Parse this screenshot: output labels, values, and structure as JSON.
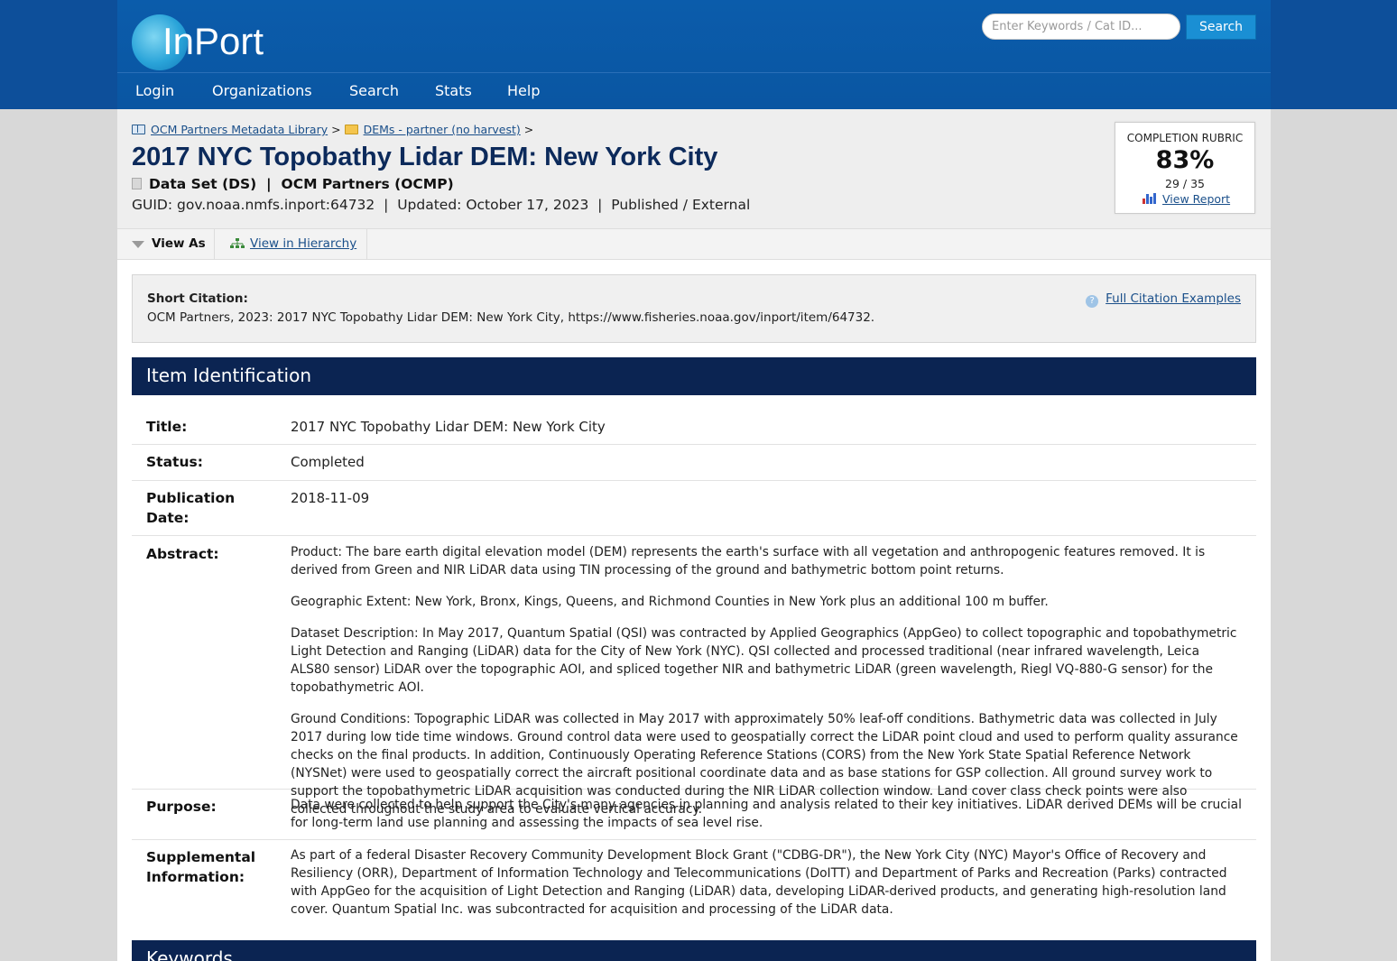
{
  "header": {
    "logo_text": "InPort",
    "search_placeholder": "Enter Keywords / Cat ID...",
    "search_button": "Search",
    "nav": [
      "Login",
      "Organizations",
      "Search",
      "Stats",
      "Help"
    ]
  },
  "breadcrumb": {
    "library": "OCM Partners Metadata Library",
    "sep1": ">",
    "folder": "DEMs - partner (no harvest)",
    "sep2": ">"
  },
  "item": {
    "title": "2017 NYC Topobathy Lidar DEM: New York City",
    "type_line": "Data Set (DS)  |  OCM Partners (OCMP)",
    "meta_line": "GUID: gov.noaa.nmfs.inport:64732  |  Updated: October 17, 2023  |  Published / External"
  },
  "rubric": {
    "label": "COMPLETION RUBRIC",
    "percent": "83%",
    "count": "29 / 35",
    "link": "View Report"
  },
  "viewbar": {
    "view_as": "View As",
    "hierarchy": "View in Hierarchy"
  },
  "citation": {
    "label": "Short Citation:",
    "text": "OCM Partners, 2023: 2017 NYC Topobathy Lidar DEM: New York City, https://www.fisheries.noaa.gov/inport/item/64732.",
    "link": "Full Citation Examples"
  },
  "sections": {
    "item_identification": "Item Identification",
    "keywords": "Keywords"
  },
  "identification": {
    "title_label": "Title:",
    "title_value": "2017 NYC Topobathy Lidar DEM: New York City",
    "status_label": "Status:",
    "status_value": "Completed",
    "pubdate_label_1": "Publication",
    "pubdate_label_2": "Date:",
    "pubdate_value": "2018-11-09",
    "abstract_label": "Abstract:",
    "abstract_p1": "Product: The bare earth digital elevation model (DEM) represents the earth's surface with all vegetation and anthropogenic features removed. It is derived from Green and NIR LiDAR data using TIN processing of the ground and bathymetric bottom point returns.",
    "abstract_p2": "Geographic Extent: New York, Bronx, Kings, Queens, and Richmond Counties in New York plus an additional 100 m buffer.",
    "abstract_p3": "Dataset Description: In May 2017, Quantum Spatial (QSI) was contracted by Applied Geographics (AppGeo) to collect topographic and topobathymetric Light Detection and Ranging (LiDAR) data for the City of New York (NYC). QSI collected and processed traditional (near infrared wavelength, Leica ALS80 sensor) LiDAR over the topographic AOI, and spliced together NIR and bathymetric LiDAR (green wavelength, Riegl VQ-880-G sensor) for the topobathymetric AOI.",
    "abstract_p4": "Ground Conditions: Topographic LiDAR was collected in May 2017 with approximately 50% leaf-off conditions. Bathymetric data was collected in July 2017 during low tide time windows. Ground control data were used to geospatially correct the LiDAR point cloud and used to perform quality assurance checks on the final products. In addition, Continuously Operating Reference Stations (CORS) from the New York State Spatial Reference Network (NYSNet) were used to geospatially correct the aircraft positional coordinate data and as base stations for GSP collection. All ground survey work to support the topobathymetric LiDAR acquisition was conducted during the NIR LiDAR collection window. Land cover class check points were also collected throughout the study area to evaluate vertical accuracy.",
    "purpose_label": "Purpose:",
    "purpose_value": "Data were collected to help support the City's many agencies in planning and analysis related to their key initiatives. LiDAR derived DEMs will be crucial for long-term land use planning and assessing the impacts of sea level rise.",
    "supp_label_1": "Supplemental",
    "supp_label_2": "Information:",
    "supp_value": "As part of a federal Disaster Recovery Community Development Block Grant (\"CDBG-DR\"), the New York City (NYC) Mayor's Office of Recovery and Resiliency (ORR), Department of Information Technology and Telecommunications (DoITT) and Department of Parks and Recreation (Parks) contracted with AppGeo for the acquisition of Light Detection and Ranging (LiDAR) data, developing LiDAR-derived products, and generating high-resolution land cover. Quantum Spatial Inc. was subcontracted for acquisition and processing of the LiDAR data."
  }
}
